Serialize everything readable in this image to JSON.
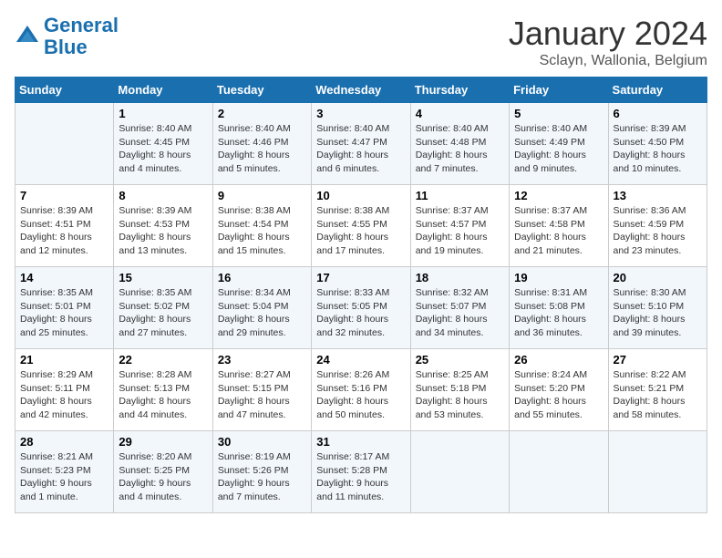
{
  "header": {
    "logo_line1": "General",
    "logo_line2": "Blue",
    "month": "January 2024",
    "location": "Sclayn, Wallonia, Belgium"
  },
  "days_of_week": [
    "Sunday",
    "Monday",
    "Tuesday",
    "Wednesday",
    "Thursday",
    "Friday",
    "Saturday"
  ],
  "weeks": [
    [
      {
        "num": "",
        "sunrise": "",
        "sunset": "",
        "daylight": ""
      },
      {
        "num": "1",
        "sunrise": "Sunrise: 8:40 AM",
        "sunset": "Sunset: 4:45 PM",
        "daylight": "Daylight: 8 hours and 4 minutes."
      },
      {
        "num": "2",
        "sunrise": "Sunrise: 8:40 AM",
        "sunset": "Sunset: 4:46 PM",
        "daylight": "Daylight: 8 hours and 5 minutes."
      },
      {
        "num": "3",
        "sunrise": "Sunrise: 8:40 AM",
        "sunset": "Sunset: 4:47 PM",
        "daylight": "Daylight: 8 hours and 6 minutes."
      },
      {
        "num": "4",
        "sunrise": "Sunrise: 8:40 AM",
        "sunset": "Sunset: 4:48 PM",
        "daylight": "Daylight: 8 hours and 7 minutes."
      },
      {
        "num": "5",
        "sunrise": "Sunrise: 8:40 AM",
        "sunset": "Sunset: 4:49 PM",
        "daylight": "Daylight: 8 hours and 9 minutes."
      },
      {
        "num": "6",
        "sunrise": "Sunrise: 8:39 AM",
        "sunset": "Sunset: 4:50 PM",
        "daylight": "Daylight: 8 hours and 10 minutes."
      }
    ],
    [
      {
        "num": "7",
        "sunrise": "Sunrise: 8:39 AM",
        "sunset": "Sunset: 4:51 PM",
        "daylight": "Daylight: 8 hours and 12 minutes."
      },
      {
        "num": "8",
        "sunrise": "Sunrise: 8:39 AM",
        "sunset": "Sunset: 4:53 PM",
        "daylight": "Daylight: 8 hours and 13 minutes."
      },
      {
        "num": "9",
        "sunrise": "Sunrise: 8:38 AM",
        "sunset": "Sunset: 4:54 PM",
        "daylight": "Daylight: 8 hours and 15 minutes."
      },
      {
        "num": "10",
        "sunrise": "Sunrise: 8:38 AM",
        "sunset": "Sunset: 4:55 PM",
        "daylight": "Daylight: 8 hours and 17 minutes."
      },
      {
        "num": "11",
        "sunrise": "Sunrise: 8:37 AM",
        "sunset": "Sunset: 4:57 PM",
        "daylight": "Daylight: 8 hours and 19 minutes."
      },
      {
        "num": "12",
        "sunrise": "Sunrise: 8:37 AM",
        "sunset": "Sunset: 4:58 PM",
        "daylight": "Daylight: 8 hours and 21 minutes."
      },
      {
        "num": "13",
        "sunrise": "Sunrise: 8:36 AM",
        "sunset": "Sunset: 4:59 PM",
        "daylight": "Daylight: 8 hours and 23 minutes."
      }
    ],
    [
      {
        "num": "14",
        "sunrise": "Sunrise: 8:35 AM",
        "sunset": "Sunset: 5:01 PM",
        "daylight": "Daylight: 8 hours and 25 minutes."
      },
      {
        "num": "15",
        "sunrise": "Sunrise: 8:35 AM",
        "sunset": "Sunset: 5:02 PM",
        "daylight": "Daylight: 8 hours and 27 minutes."
      },
      {
        "num": "16",
        "sunrise": "Sunrise: 8:34 AM",
        "sunset": "Sunset: 5:04 PM",
        "daylight": "Daylight: 8 hours and 29 minutes."
      },
      {
        "num": "17",
        "sunrise": "Sunrise: 8:33 AM",
        "sunset": "Sunset: 5:05 PM",
        "daylight": "Daylight: 8 hours and 32 minutes."
      },
      {
        "num": "18",
        "sunrise": "Sunrise: 8:32 AM",
        "sunset": "Sunset: 5:07 PM",
        "daylight": "Daylight: 8 hours and 34 minutes."
      },
      {
        "num": "19",
        "sunrise": "Sunrise: 8:31 AM",
        "sunset": "Sunset: 5:08 PM",
        "daylight": "Daylight: 8 hours and 36 minutes."
      },
      {
        "num": "20",
        "sunrise": "Sunrise: 8:30 AM",
        "sunset": "Sunset: 5:10 PM",
        "daylight": "Daylight: 8 hours and 39 minutes."
      }
    ],
    [
      {
        "num": "21",
        "sunrise": "Sunrise: 8:29 AM",
        "sunset": "Sunset: 5:11 PM",
        "daylight": "Daylight: 8 hours and 42 minutes."
      },
      {
        "num": "22",
        "sunrise": "Sunrise: 8:28 AM",
        "sunset": "Sunset: 5:13 PM",
        "daylight": "Daylight: 8 hours and 44 minutes."
      },
      {
        "num": "23",
        "sunrise": "Sunrise: 8:27 AM",
        "sunset": "Sunset: 5:15 PM",
        "daylight": "Daylight: 8 hours and 47 minutes."
      },
      {
        "num": "24",
        "sunrise": "Sunrise: 8:26 AM",
        "sunset": "Sunset: 5:16 PM",
        "daylight": "Daylight: 8 hours and 50 minutes."
      },
      {
        "num": "25",
        "sunrise": "Sunrise: 8:25 AM",
        "sunset": "Sunset: 5:18 PM",
        "daylight": "Daylight: 8 hours and 53 minutes."
      },
      {
        "num": "26",
        "sunrise": "Sunrise: 8:24 AM",
        "sunset": "Sunset: 5:20 PM",
        "daylight": "Daylight: 8 hours and 55 minutes."
      },
      {
        "num": "27",
        "sunrise": "Sunrise: 8:22 AM",
        "sunset": "Sunset: 5:21 PM",
        "daylight": "Daylight: 8 hours and 58 minutes."
      }
    ],
    [
      {
        "num": "28",
        "sunrise": "Sunrise: 8:21 AM",
        "sunset": "Sunset: 5:23 PM",
        "daylight": "Daylight: 9 hours and 1 minute."
      },
      {
        "num": "29",
        "sunrise": "Sunrise: 8:20 AM",
        "sunset": "Sunset: 5:25 PM",
        "daylight": "Daylight: 9 hours and 4 minutes."
      },
      {
        "num": "30",
        "sunrise": "Sunrise: 8:19 AM",
        "sunset": "Sunset: 5:26 PM",
        "daylight": "Daylight: 9 hours and 7 minutes."
      },
      {
        "num": "31",
        "sunrise": "Sunrise: 8:17 AM",
        "sunset": "Sunset: 5:28 PM",
        "daylight": "Daylight: 9 hours and 11 minutes."
      },
      {
        "num": "",
        "sunrise": "",
        "sunset": "",
        "daylight": ""
      },
      {
        "num": "",
        "sunrise": "",
        "sunset": "",
        "daylight": ""
      },
      {
        "num": "",
        "sunrise": "",
        "sunset": "",
        "daylight": ""
      }
    ]
  ]
}
